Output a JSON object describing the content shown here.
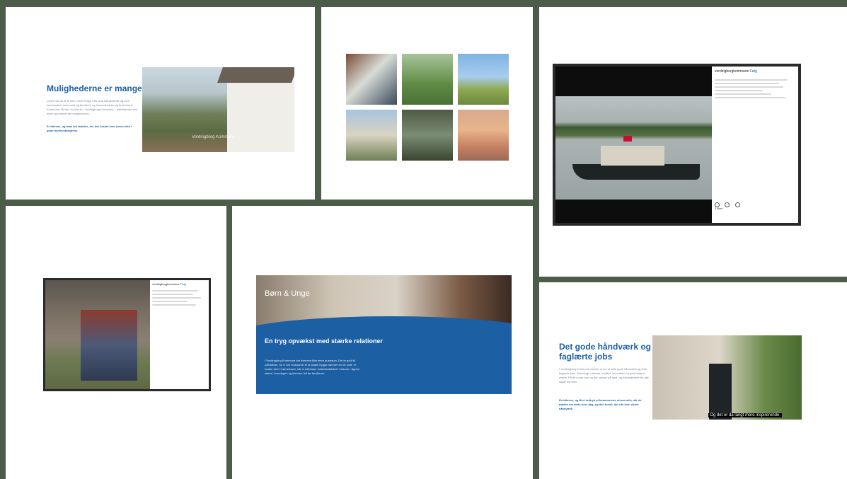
{
  "colors": {
    "background": "#4b5d49",
    "brand_blue": "#1d5fa3",
    "panel": "#ffffff"
  },
  "slide_opportunities": {
    "heading": "Mulighederne er mange",
    "body": "Lorem ips du til at leve, mest muligt i din sma udtrykknede og som kombination med vand og fjordlivet, og busmad udder og fo sharutrie Kommune. Broker du ude liv i Vordingborg Kommune – aktiviteterne ved bryst og boende de mulighederne.",
    "emphasis": "Er tidevne, og mød hin familier, der har fundet hver deres sted i gode dyrelivsborgerne.",
    "video_caption": "Vordingborg Kommune"
  },
  "slide_children": {
    "banner_title": "Børn & Unge",
    "heading": "En tryg opvækst med stærke relationer",
    "body": "I Vordingborg Kommune har børnene fået mere pusterum. Det er godt til udfoldelse, for vi har ressourcer til at skabe trygge rammer for de små. Vi møder dem i børnehaver, når vi udforsker kulturlandskabet i naturen. Appen større i hverdagen og kommer lidt før familierne."
  },
  "slide_crafts": {
    "heading": "Det gode håndværk og faglærte jobs",
    "body": "I Vordingborg Kommune værner vi om at løfte gode håndværk og fede faglærte jobs. Teknologi, nærhed, kvalitet, innovation og godt miljø at snyde. På de koner stor og det varmer på land, og håndværkere fra alle sager kommer.",
    "emphasis": "En tidevne, og få et indtryk af kommunens erhvervsliv, når de mødes om dette hver dag, og den kunst, der når hver deres håndværk.",
    "video_subtitle": "Og det er da langt mere inspirerende."
  },
  "instagram_ferry": {
    "account": "vordingborgkommune",
    "follow": "Følg",
    "likes": "3 likes"
  },
  "instagram_family": {
    "account": "vordingborgkommune",
    "follow": "Følg"
  }
}
